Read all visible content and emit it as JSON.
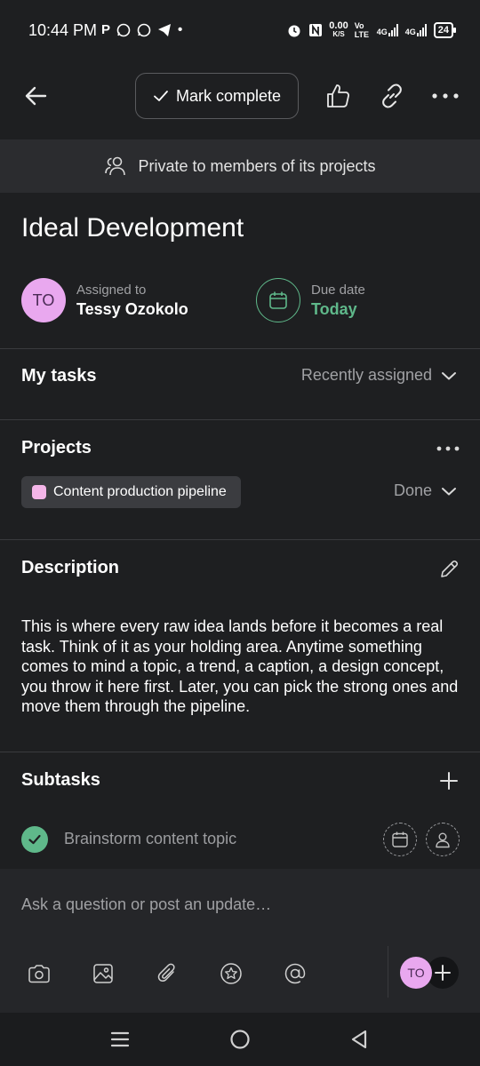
{
  "status_bar": {
    "time": "10:44 PM",
    "left_icons": [
      "P",
      "whatsapp-icon",
      "whatsapp-icon",
      "telegram-icon",
      "•"
    ],
    "net_speed": "0.00",
    "net_unit": "K/S",
    "volte": "Vo LTE",
    "signal1": "4G",
    "signal2": "4G",
    "battery": "24"
  },
  "header": {
    "mark_complete_label": "Mark complete"
  },
  "privacy": {
    "text": "Private to members of its projects"
  },
  "task": {
    "title": "Ideal Development",
    "assignee": {
      "label": "Assigned to",
      "name": "Tessy Ozokolo",
      "initials": "TO"
    },
    "due": {
      "label": "Due date",
      "value": "Today"
    }
  },
  "my_tasks": {
    "label": "My tasks",
    "section": "Recently assigned"
  },
  "projects": {
    "label": "Projects",
    "items": [
      {
        "name": "Content production pipeline",
        "section": "Done",
        "color": "#f4b5e8"
      }
    ]
  },
  "description": {
    "label": "Description",
    "text": "This is where every raw idea lands before it becomes a real task. Think of it as your holding area. Anytime something comes to mind a topic, a trend, a caption, a design concept, you throw it here first. Later, you can pick the strong ones and move them through the pipeline."
  },
  "subtasks": {
    "label": "Subtasks",
    "items": [
      {
        "name": "Brainstorm content topic",
        "completed": true
      }
    ]
  },
  "composer": {
    "placeholder": "Ask a question or post an update…",
    "avatar_initials": "TO"
  },
  "colors": {
    "accent_green": "#5fb88a",
    "avatar_pink": "#e9a8ef",
    "background": "#1e1f21"
  }
}
